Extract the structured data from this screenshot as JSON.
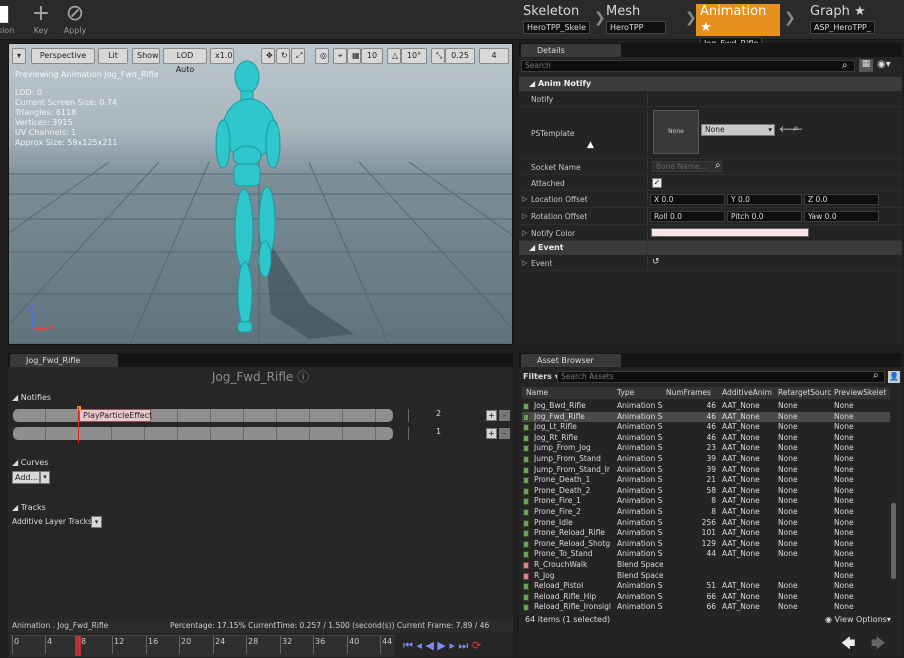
{
  "toolbar": {
    "left_label": "ssion",
    "key": "Key",
    "apply": "Apply",
    "crumbs": [
      {
        "title": "Skeleton",
        "sub": "HeroTPP_Skele"
      },
      {
        "title": "Mesh",
        "sub": "HeroTPP"
      },
      {
        "title": "Animation ★",
        "sub": "Jog_Fwd_Rifle"
      },
      {
        "title": "Graph ★",
        "sub": "ASP_HeroTPP_"
      }
    ]
  },
  "viewport": {
    "buttons": [
      "Perspective",
      "Lit",
      "Show",
      "LOD Auto",
      "x1.0",
      "10",
      "10°",
      "0.25",
      "4"
    ],
    "previewing": "Previewing Animation Jog_Fwd_Rifle",
    "stats": [
      "LOD: 0",
      "Current Screen Size: 0.74",
      "Triangles: 6118",
      "Vertices: 3915",
      "UV Channels: 1",
      "Approx Size: 59x125x211"
    ],
    "axis_x": "X",
    "axis_z": "Z"
  },
  "details": {
    "tab": "Details",
    "search_placeholder": "Search",
    "section_notify": "Anim Notify",
    "notify": "Notify",
    "pstemplate": "PSTemplate",
    "thumb": "None",
    "template_value": "None",
    "socket_name": "Socket Name",
    "socket_placeholder": "Bone Name...",
    "attached": "Attached",
    "location_offset": "Location Offset",
    "rotation_offset": "Rotation Offset",
    "notify_color": "Notify Color",
    "loc": [
      "X  0.0",
      "Y  0.0",
      "Z  0.0"
    ],
    "rot": [
      "Roll  0.0",
      "Pitch  0.0",
      "Yaw  0.0"
    ],
    "section_event": "Event",
    "event": "Event",
    "notify_color_hex": "#f8e4e4"
  },
  "timeline": {
    "tab": "Jog_Fwd_Rifle",
    "title": "Jog_Fwd_Rifle",
    "notifies": "Notifies",
    "notify_name": "PlayParticleEffect",
    "track1_num": "2",
    "track2_num": "1",
    "curves": "Curves",
    "add": "Add...",
    "tracks": "Tracks",
    "additive": "Additive Layer Tracks",
    "status_left": "Animation . Jog_Fwd_Rifle",
    "status_right": "Percentage: 17.15% CurrentTime: 0.257 / 1.500 (second(s)) Current Frame: 7.89 / 46 (key(s))",
    "ticks": [
      "0",
      "4",
      "8",
      "12",
      "16",
      "20",
      "24",
      "28",
      "32",
      "36",
      "40",
      "44"
    ],
    "current_frame": 7.89,
    "total_frames": 46
  },
  "assets": {
    "tab": "Asset Browser",
    "filters": "Filters",
    "search_placeholder": "Search Assets",
    "columns": [
      "Name",
      "Type",
      "NumFrames",
      "AdditiveAnim",
      "RetargetSourc",
      "PreviewSkelet"
    ],
    "rows": [
      [
        "Jog_Bwd_Rifle",
        "Animation Se",
        "46",
        "AAT_None",
        "None",
        "None"
      ],
      [
        "Jog_Fwd_Rifle",
        "Animation Se",
        "46",
        "AAT_None",
        "None",
        "None"
      ],
      [
        "Jog_Lt_Rifle",
        "Animation Se",
        "46",
        "AAT_None",
        "None",
        "None"
      ],
      [
        "Jog_Rt_Rifle",
        "Animation Se",
        "46",
        "AAT_None",
        "None",
        "None"
      ],
      [
        "Jump_From_Jog",
        "Animation Se",
        "23",
        "AAT_None",
        "None",
        "None"
      ],
      [
        "Jump_From_Stand",
        "Animation Se",
        "39",
        "AAT_None",
        "None",
        "None"
      ],
      [
        "Jump_From_Stand_Ir",
        "Animation Se",
        "39",
        "AAT_None",
        "None",
        "None"
      ],
      [
        "Prone_Death_1",
        "Animation Se",
        "21",
        "AAT_None",
        "None",
        "None"
      ],
      [
        "Prone_Death_2",
        "Animation Se",
        "58",
        "AAT_None",
        "None",
        "None"
      ],
      [
        "Prone_Fire_1",
        "Animation Se",
        "8",
        "AAT_None",
        "None",
        "None"
      ],
      [
        "Prone_Fire_2",
        "Animation Se",
        "8",
        "AAT_None",
        "None",
        "None"
      ],
      [
        "Prone_Idle",
        "Animation Se",
        "256",
        "AAT_None",
        "None",
        "None"
      ],
      [
        "Prone_Reload_Rifle",
        "Animation Se",
        "101",
        "AAT_None",
        "None",
        "None"
      ],
      [
        "Prone_Reload_Shotg",
        "Animation Se",
        "129",
        "AAT_None",
        "None",
        "None"
      ],
      [
        "Prone_To_Stand",
        "Animation Se",
        "44",
        "AAT_None",
        "None",
        "None"
      ],
      [
        "R_CrouchWalk",
        "Blend Space",
        "",
        "",
        "",
        "None"
      ],
      [
        "R_Jog",
        "Blend Space",
        "",
        "",
        "",
        "None"
      ],
      [
        "Reload_Pistol",
        "Animation Se",
        "51",
        "AAT_None",
        "None",
        "None"
      ],
      [
        "Reload_Rifle_Hip",
        "Animation Se",
        "66",
        "AAT_None",
        "None",
        "None"
      ],
      [
        "Reload_Rifle_Ironsigl",
        "Animation Se",
        "66",
        "AAT_None",
        "None",
        "None"
      ]
    ],
    "selected_index": 1,
    "count": "64 items (1 selected)",
    "view_options": "View Options▾"
  }
}
